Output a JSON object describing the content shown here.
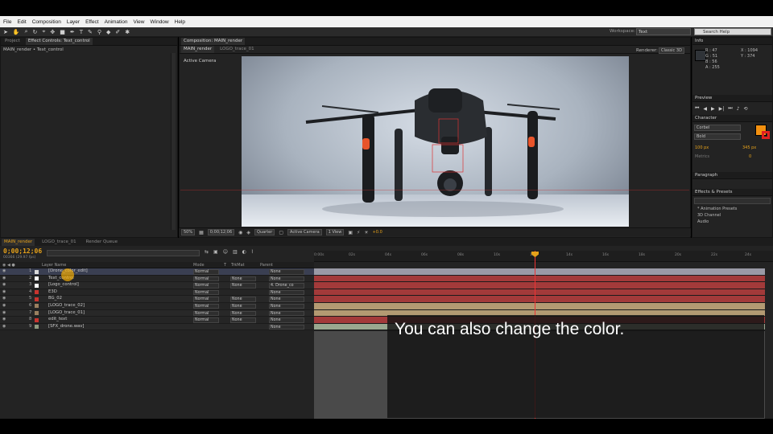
{
  "menu": [
    "File",
    "Edit",
    "Composition",
    "Layer",
    "Effect",
    "Animation",
    "View",
    "Window",
    "Help"
  ],
  "toolbar": {
    "workspace_label": "Workspace:",
    "workspace_value": "Text",
    "search_placeholder": "Search Help"
  },
  "left_panel": {
    "tabs": [
      "Project",
      "Effect Controls: Text_control"
    ],
    "breadcrumb": "MAIN_render • Text_control"
  },
  "composition": {
    "tab_label": "Composition: MAIN_render",
    "subtabs": [
      "MAIN_render",
      "LOGO_trace_01"
    ],
    "renderer_label": "Renderer:",
    "renderer_value": "Classic 3D",
    "camera_label": "Active Camera",
    "bottom_bar": {
      "zoom": "50%",
      "timecode": "0;00;12;06",
      "resolution": "Quarter",
      "camera": "Active Camera",
      "view": "1 View",
      "exposure": "+0.0"
    }
  },
  "info_panel": {
    "title": "Info",
    "r": "R : 47",
    "g": "G : 51",
    "b": "B : 56",
    "a": "A : 255",
    "x": "X : 1094",
    "y": "Y : 374"
  },
  "preview_panel": {
    "title": "Preview"
  },
  "character_panel": {
    "title": "Character",
    "font": "Corbel",
    "style": "Bold",
    "size": "100 px",
    "leading": "345 px",
    "tracking": "Metrics",
    "kerning": "0",
    "fill_color": "#f29010",
    "stroke_color": "#e02020"
  },
  "paragraph_panel": {
    "title": "Paragraph"
  },
  "effects_panel": {
    "title": "Effects & Presets",
    "items": [
      "* Animation Presets",
      "3D Channel",
      "Audio"
    ]
  },
  "timeline": {
    "tabs": [
      "MAIN_render",
      "LOGO_trace_01",
      "Render Queue"
    ],
    "timecode": "0;00;12;06",
    "timecode_sub": "00366 (29.97 fps)",
    "column_headers": {
      "layer_name": "Layer Name",
      "mode": "Mode",
      "t": "T",
      "trkmat": "TrkMat",
      "parent": "Parent"
    },
    "ruler_labels": [
      "0:00s",
      "02s",
      "04s",
      "06s",
      "08s",
      "10s",
      "12s",
      "14s",
      "16s",
      "18s",
      "20s",
      "22s",
      "24s"
    ],
    "layers": [
      {
        "num": "1",
        "name": "[Drone_color_edit]",
        "label_color": "#d9d9d9",
        "mode": "Normal",
        "trkmat": "",
        "parent": "None",
        "bar_color": "#9a9aa6"
      },
      {
        "num": "2",
        "name": "Text_control",
        "label_color": "#ffffff",
        "mode": "Normal",
        "trkmat": "None",
        "parent": "None",
        "bar_color": "#a33a3a"
      },
      {
        "num": "3",
        "name": "[Logo_control]",
        "label_color": "#ffffff",
        "mode": "Normal",
        "trkmat": "None",
        "parent": "4. Drone_co",
        "bar_color": "#a33a3a"
      },
      {
        "num": "4",
        "name": "E3D",
        "label_color": "#c8342f",
        "mode": "Normal",
        "trkmat": "",
        "parent": "None",
        "bar_color": "#a33a3a"
      },
      {
        "num": "5",
        "name": "BG_02",
        "label_color": "#c8342f",
        "mode": "Normal",
        "trkmat": "None",
        "parent": "None",
        "bar_color": "#a33a3a"
      },
      {
        "num": "6",
        "name": "[LOGO_trace_02]",
        "label_color": "#9a8060",
        "mode": "Normal",
        "trkmat": "None",
        "parent": "None",
        "bar_color": "#b39a72"
      },
      {
        "num": "7",
        "name": "[LOGO_trace_01]",
        "label_color": "#9a8060",
        "mode": "Normal",
        "trkmat": "None",
        "parent": "None",
        "bar_color": "#b39a72"
      },
      {
        "num": "8",
        "name": "edit_text",
        "label_color": "#c8342f",
        "mode": "Normal",
        "trkmat": "None",
        "parent": "None",
        "bar_color": "#a33a3a"
      },
      {
        "num": "9",
        "name": "[SFX_drone.wav]",
        "label_color": "#8f9a80",
        "mode": "",
        "trkmat": "",
        "parent": "None",
        "bar_color": "#9aa890"
      }
    ]
  },
  "subtitle": "You can also change the color."
}
